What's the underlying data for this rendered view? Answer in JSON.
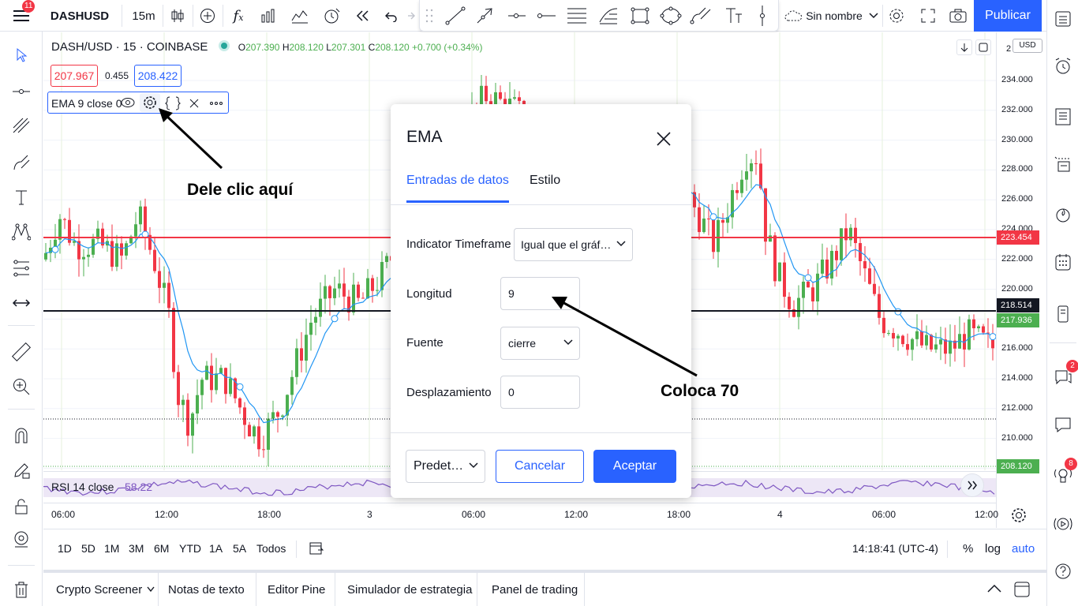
{
  "topbar": {
    "menu_badge": "11",
    "symbol": "DASHUSD",
    "interval": "15m",
    "layout_name": "Sin nombre",
    "publish_label": "Publicar"
  },
  "legend": {
    "title": "DASH/USD · 15 · COINBASE",
    "open_label": "O",
    "open": "207.390",
    "high_label": "H",
    "high": "208.120",
    "low_label": "L",
    "low": "207.301",
    "close_label": "C",
    "close": "208.120",
    "change": "+0.700 (+0.34%)",
    "bid": "207.967",
    "spread": "0.455",
    "ask": "208.422"
  },
  "indicator": {
    "label": "EMA 9 close 0"
  },
  "rsi": {
    "label": "RSI 14 close",
    "value": "58.22"
  },
  "price_axis": {
    "currency": "USD",
    "top_label": "2",
    "labels": [
      "234.000",
      "232.000",
      "230.000",
      "228.000",
      "226.000",
      "224.000",
      "222.000",
      "220.000",
      "218.000",
      "216.000",
      "214.000",
      "212.000",
      "210.000"
    ],
    "tag_red": "223.454",
    "tag_black": "218.514",
    "tag_green": "217.936",
    "tag_last": "208.120",
    "colors": {
      "red": "#f23645",
      "black": "#131722",
      "green": "#4caf50"
    }
  },
  "time_axis": {
    "labels": [
      "06:00",
      "12:00",
      "18:00",
      "3",
      "06:00",
      "12:00",
      "18:00",
      "4",
      "06:00",
      "12:00"
    ]
  },
  "bottom": {
    "ranges": [
      "1D",
      "5D",
      "1M",
      "3M",
      "6M",
      "YTD",
      "1A",
      "5A",
      "Todos"
    ],
    "clock": "14:18:41 (UTC-4)",
    "percent": "%",
    "log": "log",
    "auto": "auto"
  },
  "tabs": [
    "Crypto Screener",
    "Notas de texto",
    "Editor Pine",
    "Simulador de estrategia",
    "Panel de trading"
  ],
  "dialog": {
    "title": "EMA",
    "tab_inputs": "Entradas de datos",
    "tab_style": "Estilo",
    "timeframe_label": "Indicator Timeframe",
    "timeframe_value": "Igual que el gráf…",
    "length_label": "Longitud",
    "length_value": "9",
    "source_label": "Fuente",
    "source_value": "cierre",
    "offset_label": "Desplazamiento",
    "offset_value": "0",
    "defaults_label": "Predet…",
    "cancel_label": "Cancelar",
    "ok_label": "Aceptar"
  },
  "annotations": {
    "click_here": "Dele clic aquí",
    "set_70": "Coloca 70"
  },
  "right_badges": {
    "chat": "2",
    "notifications": "8"
  },
  "colors": {
    "accent": "#2962ff",
    "up": "#4caf50",
    "down": "#f23645",
    "ema": "#2196f3",
    "rsi": "#7e57c2"
  }
}
